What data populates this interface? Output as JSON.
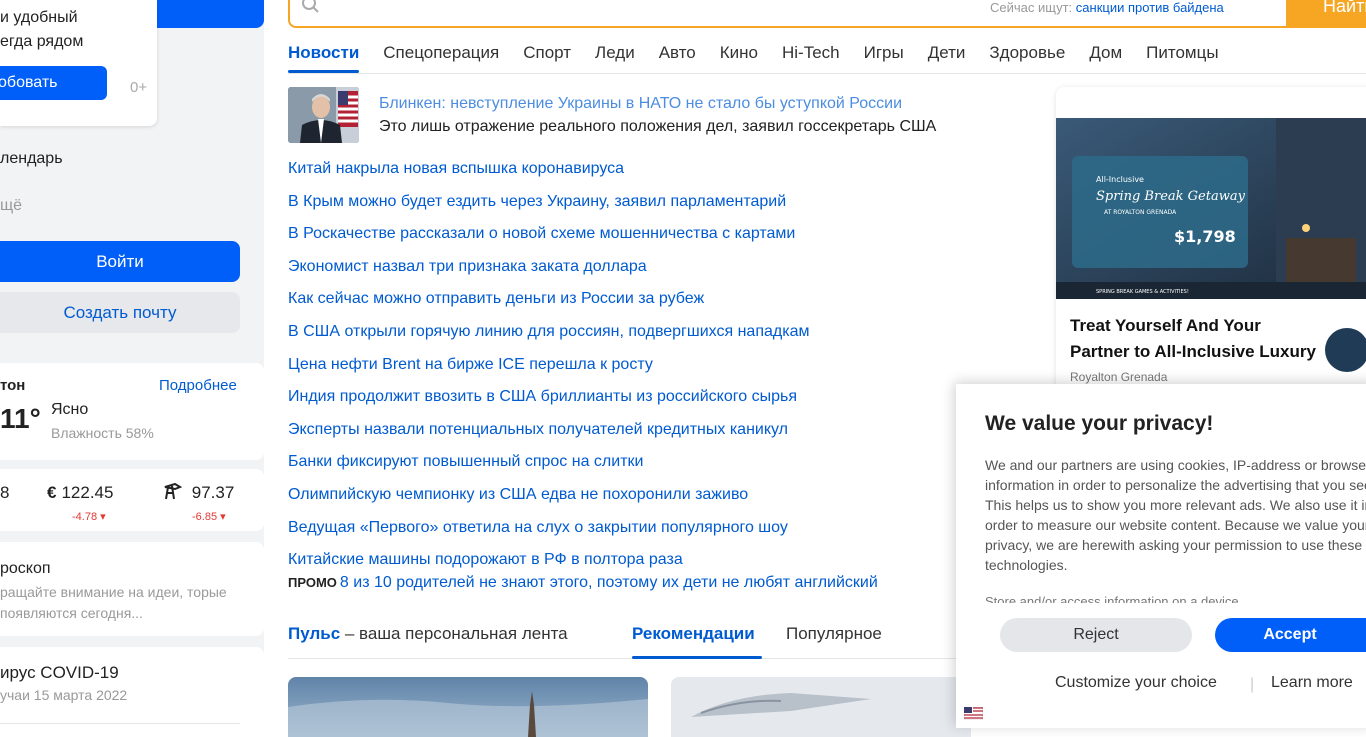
{
  "left": {
    "promo_text_line1": "и удобный",
    "promo_text_line2": "егда рядом",
    "try_label": "обовать",
    "age_badge": "0+",
    "calendar_label": "лендарь",
    "more_label": "щё",
    "login_label": "Войти",
    "create_mail_label": "Создать почту",
    "weather": {
      "city": "тон",
      "more_label": "Подробнее",
      "temp": "11°",
      "condition": "Ясно",
      "humidity": "Влажность 58%"
    },
    "rates": {
      "usd_value": "8",
      "eur_value": "122.45",
      "eur_change": "-4.78 ▾",
      "oil_value": "97.37",
      "oil_change": "-6.85 ▾"
    },
    "horoscope": {
      "title": "роскоп",
      "text": "ращайте внимание на идеи, торые появляются сегодня..."
    },
    "covid": {
      "title": "ирус COVID-19",
      "date": "учаи 15 марта 2022"
    }
  },
  "search": {
    "hint_prefix": "Сейчас ищут:",
    "hint_query": "санкции против байдена",
    "button_label": "Найти"
  },
  "tabs": [
    "Новости",
    "Спецоперация",
    "Спорт",
    "Леди",
    "Авто",
    "Кино",
    "Hi-Tech",
    "Игры",
    "Дети",
    "Здоровье",
    "Дом",
    "Питомцы"
  ],
  "lead_news": {
    "title": "Блинкен: невступление Украины в НАТО не стало бы уступкой России",
    "subtitle": "Это лишь отражение реального положения дел, заявил госсекретарь США"
  },
  "news": [
    "Китай накрыла новая вспышка коронавируса",
    "В Крым можно будет ездить через Украину, заявил парламентарий",
    "В Роскачестве рассказали о новой схеме мошенничества с картами",
    "Экономист назвал три признака заката доллара",
    "Как сейчас можно отправить деньги из России за рубеж",
    "В США открыли горячую линию для россиян, подвергшихся нападкам",
    "Цена нефти Brent на бирже ICE перешла к росту",
    "Индия продолжит ввозить в США бриллианты из российского сырья",
    "Эксперты назвали потенциальных получателей кредитных каникул",
    "Банки фиксируют повышенный спрос на слитки",
    "Олимпийскую чемпионку из США едва не похоронили заживо",
    "Ведущая «Первого» ответила на слух о закрытии популярного шоу",
    "Китайские машины подорожают в РФ в полтора раза"
  ],
  "promo_news": {
    "label": "ПРОМО",
    "text": "8 из 10 родителей не знают этого, поэтому их дети не любят английский"
  },
  "feed": {
    "pulse": "Пульс",
    "pulse_rest": " – ваша персональная лента",
    "recommendations": "Рекомендации",
    "popular": "Популярное"
  },
  "ad": {
    "title": "Treat Yourself And Your Partner to All-Inclusive Luxury",
    "source": "Royalton Grenada",
    "banner_line1": "All-Inclusive",
    "banner_line2": "Spring Break Getaway",
    "banner_line3": "AT ROYALTON GRENADA",
    "banner_price": "$1,798",
    "banner_footer": "SPRING BREAK GAMES & ACTIVITIES!"
  },
  "privacy": {
    "title": "We value your privacy!",
    "text": "We and our partners are using cookies, IP-address or browser information in order to personalize the advertising that you see. This helps us to show you more relevant ads. We also use it in order to measure our website content. Because we value your privacy, we are herewith asking your permission to use these technologies.",
    "fade_text": "Store and/or access information on a device",
    "reject_label": "Reject",
    "accept_label": "Accept",
    "customize_label": "Customize your choice",
    "separator": "|",
    "learn_label": "Learn more"
  },
  "colors": {
    "brand_blue": "#005ff9",
    "link_blue": "#005bd1",
    "search_orange": "#f6a623",
    "down_red": "#e53935"
  }
}
